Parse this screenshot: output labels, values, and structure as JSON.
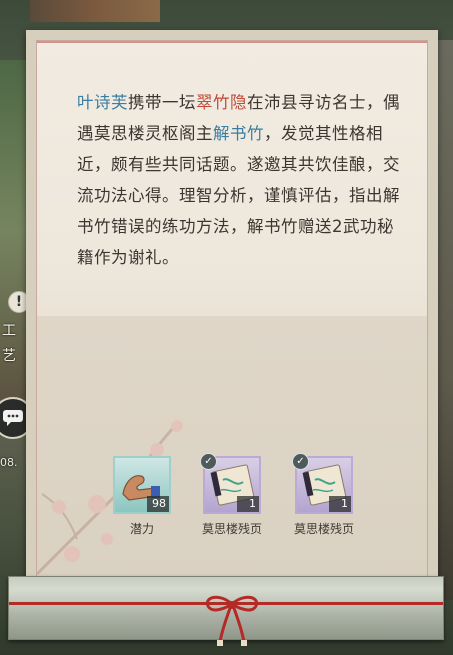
{
  "side": {
    "alert_glyph": "!",
    "label_top": "工",
    "label_bottom": "艺",
    "number": "08."
  },
  "story": {
    "parts": [
      {
        "text": "叶诗芙",
        "kind": "name"
      },
      {
        "text": "携带一坛",
        "kind": "plain"
      },
      {
        "text": "翠竹隐",
        "kind": "item"
      },
      {
        "text": "在沛县寻访名士，偶遇莫思楼灵枢阁主",
        "kind": "plain"
      },
      {
        "text": "解书竹",
        "kind": "name"
      },
      {
        "text": "，发觉其性格相近，颇有些共同话题。遂邀其共饮佳酿，交流功法心得。理智分析，谨慎评估，指出解书竹错误的练功方法，解书竹赠送2武功秘籍作为谢礼。",
        "kind": "plain"
      }
    ]
  },
  "rewards": [
    {
      "label": "潜力",
      "count": "98",
      "icon": "flexed-arm-icon",
      "checked": false,
      "frame_color": "#8cc6c1"
    },
    {
      "label": "莫思楼残页",
      "count": "1",
      "icon": "scroll-page-icon",
      "checked": true,
      "frame_color": "#b3a4cf"
    },
    {
      "label": "莫思楼残页",
      "count": "1",
      "icon": "scroll-page-icon",
      "checked": true,
      "frame_color": "#b3a4cf"
    }
  ],
  "colors": {
    "name_highlight": "#3b7ea0",
    "item_highlight": "#c24a3a",
    "cord": "#b32a26"
  }
}
